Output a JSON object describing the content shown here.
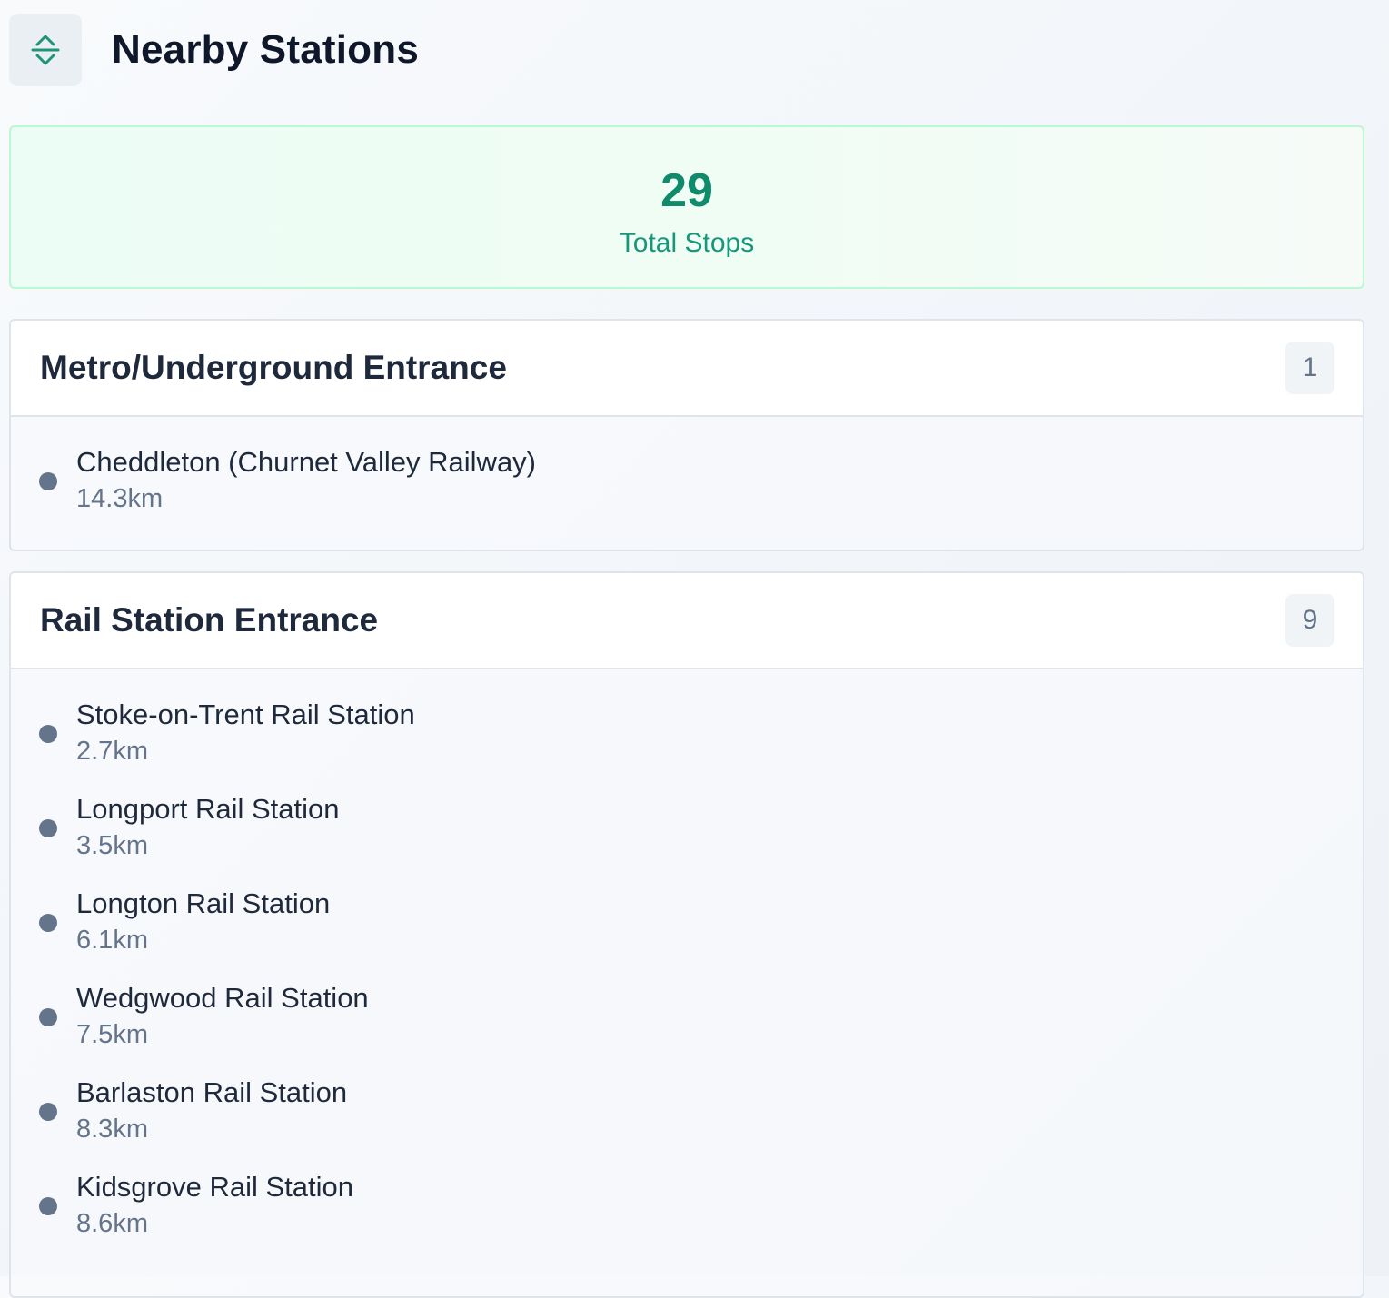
{
  "header": {
    "title": "Nearby Stations",
    "toggle_icon": "expand-collapse-icon"
  },
  "summary": {
    "total_count": "29",
    "total_label": "Total Stops"
  },
  "groups": [
    {
      "title": "Metro/Underground Entrance",
      "count": "1",
      "stops": [
        {
          "name": "Cheddleton (Churnet Valley Railway)",
          "distance": "14.3km"
        }
      ]
    },
    {
      "title": "Rail Station Entrance",
      "count": "9",
      "stops": [
        {
          "name": "Stoke-on-Trent Rail Station",
          "distance": "2.7km"
        },
        {
          "name": "Longport Rail Station",
          "distance": "3.5km"
        },
        {
          "name": "Longton Rail Station",
          "distance": "6.1km"
        },
        {
          "name": "Wedgwood Rail Station",
          "distance": "7.5km"
        },
        {
          "name": "Barlaston Rail Station",
          "distance": "8.3km"
        },
        {
          "name": "Kidsgrove Rail Station",
          "distance": "8.6km"
        }
      ]
    }
  ],
  "colors": {
    "accent": "#0f8a6a",
    "summary_border": "#bbf7d0",
    "dot": "#64748b"
  }
}
